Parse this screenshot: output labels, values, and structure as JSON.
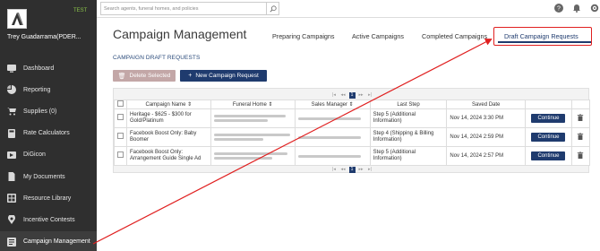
{
  "env_tag": "TEST",
  "user_name": "Trey Guadarrama(PDER...",
  "search": {
    "placeholder": "Search agents, funeral homes, and policies"
  },
  "sidebar": {
    "items": [
      {
        "label": "Dashboard",
        "icon": "dashboard-icon"
      },
      {
        "label": "Reporting",
        "icon": "pie-chart-icon"
      },
      {
        "label": "Supplies (0)",
        "icon": "cart-icon"
      },
      {
        "label": "Rate Calculators",
        "icon": "calculator-icon"
      },
      {
        "label": "DiGicon",
        "icon": "digicon-icon"
      },
      {
        "label": "My Documents",
        "icon": "document-icon"
      },
      {
        "label": "Resource Library",
        "icon": "library-icon"
      },
      {
        "label": "Incentive Contests",
        "icon": "map-pin-icon"
      },
      {
        "label": "Campaign Management",
        "icon": "campaign-icon"
      }
    ]
  },
  "header": {
    "title": "Campaign Management",
    "tabs": [
      {
        "label": "Preparing Campaigns"
      },
      {
        "label": "Active Campaigns"
      },
      {
        "label": "Completed Campaigns"
      },
      {
        "label": "Draft Campaign Requests"
      }
    ]
  },
  "section_title": "CAMPAIGN DRAFT REQUESTS",
  "buttons": {
    "delete_label": "Delete Selected",
    "new_label": "New Campaign Request"
  },
  "pager": {
    "first": "|◂",
    "prev": "◂◂",
    "current": "1",
    "next": "▸▸",
    "last": "▸|"
  },
  "table": {
    "headers": [
      "Campaign Name",
      "Funeral Home",
      "Sales Manager",
      "Last Step",
      "Saved Date"
    ],
    "rows": [
      {
        "name": "Heritage - $625 - $300 for Gold/Platinum",
        "last_step": "Step 5 (Additional Information)",
        "saved_date": "Nov 14, 2024 3:30 PM",
        "action": "Continue"
      },
      {
        "name": "Facebook Boost Only: Baby Boomer",
        "last_step": "Step 4 (Shipping & Billing Information)",
        "saved_date": "Nov 14, 2024 2:59 PM",
        "action": "Continue"
      },
      {
        "name": "Facebook Boost Only: Arrangement Guide Single Ad",
        "last_step": "Step 5 (Additional Information)",
        "saved_date": "Nov 14, 2024 2:57 PM",
        "action": "Continue"
      }
    ]
  },
  "colors": {
    "sidebar_bg": "#2f2f2f",
    "brand_navy": "#1f3b6e",
    "annotation_red": "#e02020",
    "env_green": "#8bc34a"
  }
}
